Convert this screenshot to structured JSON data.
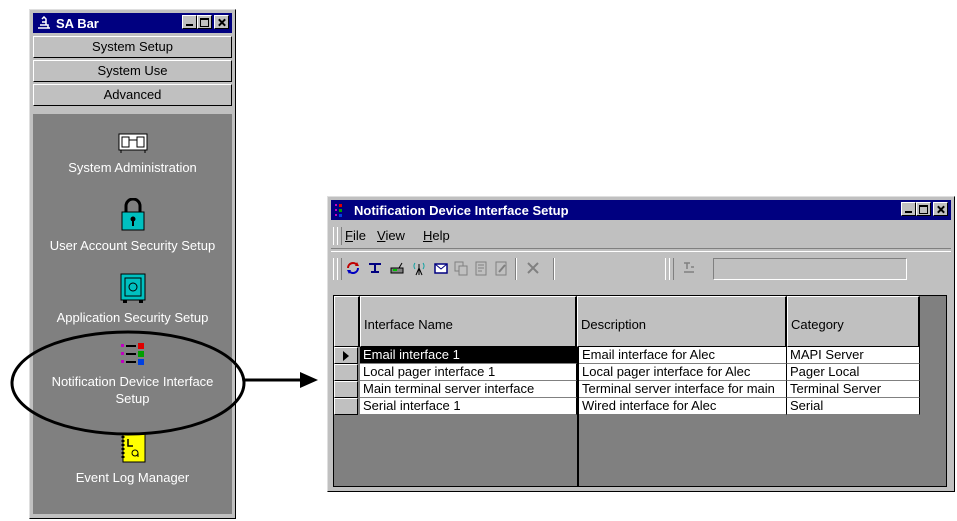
{
  "sabar": {
    "title": "SA Bar",
    "tabs": [
      "System Setup",
      "System Use",
      "Advanced"
    ],
    "items": [
      {
        "label": "System Administration",
        "icon": "server-icon"
      },
      {
        "label": "User Account Security Setup",
        "icon": "padlock-icon"
      },
      {
        "label": "Application Security Setup",
        "icon": "safe-icon"
      },
      {
        "label": "Notification Device Interface Setup",
        "icon": "notification-list-icon"
      },
      {
        "label": "Event Log Manager",
        "icon": "log-notebook-icon"
      }
    ]
  },
  "notification_window": {
    "title": "Notification Device Interface Setup",
    "menu": [
      {
        "prefix": "",
        "hotkey": "F",
        "rest": "ile"
      },
      {
        "prefix": "",
        "hotkey": "V",
        "rest": "iew"
      },
      {
        "prefix": "",
        "hotkey": "H",
        "rest": "elp"
      }
    ],
    "toolbar_icons": [
      "refresh-icon",
      "interface-icon",
      "pager-icon",
      "antenna-icon",
      "mail-icon",
      "copy-icon",
      "properties-icon",
      "edit-icon",
      "delete-icon",
      "filter-icon"
    ],
    "columns": [
      "Interface Name",
      "Description",
      "Category"
    ],
    "rows": [
      [
        "Email interface 1",
        "Email interface for Alec",
        "MAPI Server"
      ],
      [
        "Local pager interface 1",
        "Local pager interface for Alec",
        "Pager Local"
      ],
      [
        "Main terminal server interface",
        "Terminal server interface for main",
        "Terminal Server"
      ],
      [
        "Serial interface 1",
        "Wired interface for Alec",
        "Serial"
      ]
    ]
  },
  "colors": {
    "titlebar": "#000080",
    "face": "#c0c0c0",
    "panel": "#808080",
    "highlight": "#000000"
  }
}
